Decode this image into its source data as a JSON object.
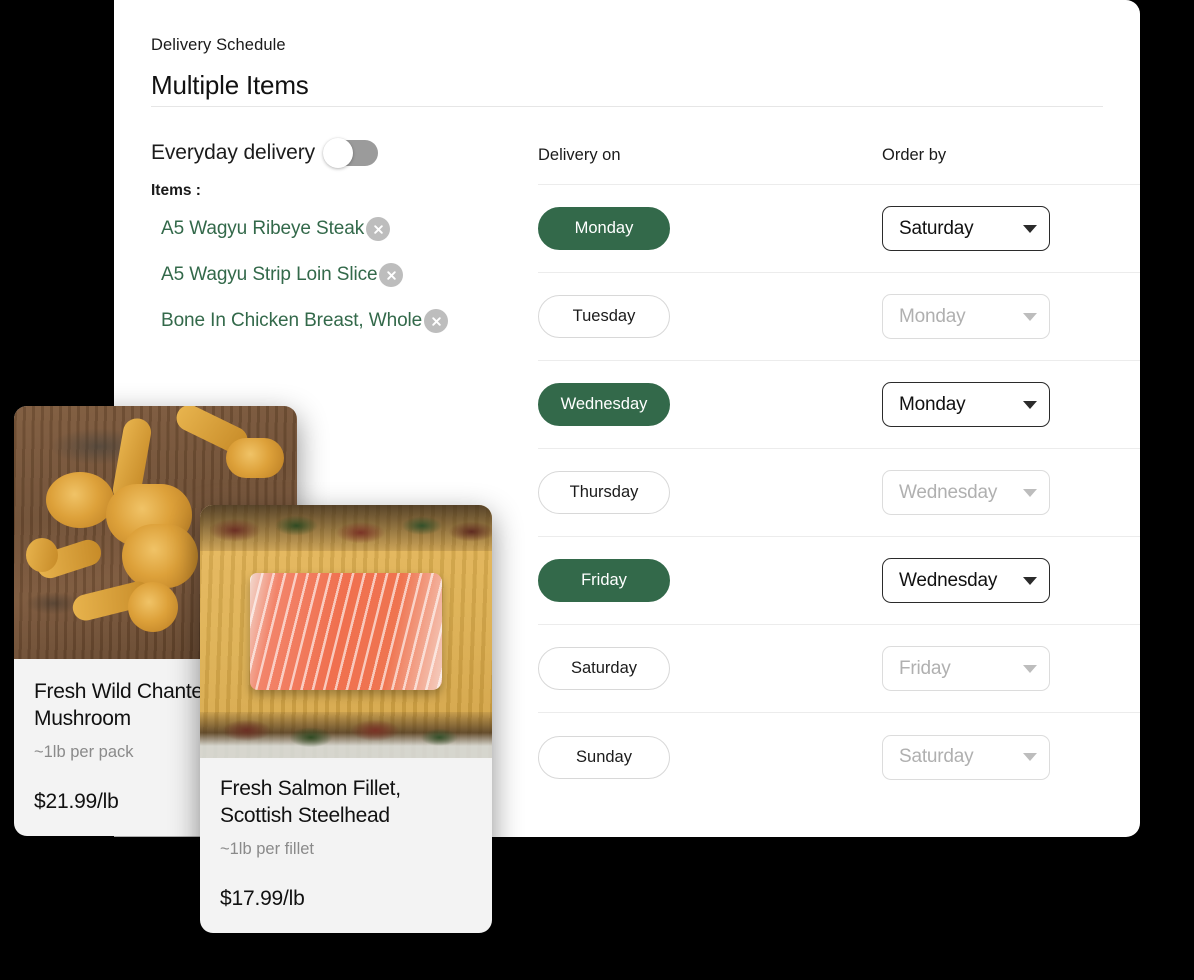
{
  "panel": {
    "eyebrow": "Delivery Schedule",
    "title": "Multiple Items"
  },
  "options": {
    "everyday_delivery_label": "Everyday delivery",
    "everyday_delivery_on": false,
    "items_label": "Items :",
    "items": [
      {
        "name": "A5 Wagyu Ribeye Steak",
        "remove_icon": "close-circle-icon"
      },
      {
        "name": "A5 Wagyu Strip Loin Slice",
        "remove_icon": "close-circle-icon"
      },
      {
        "name": "Bone In Chicken Breast, Whole",
        "remove_icon": "close-circle-icon"
      }
    ]
  },
  "schedule": {
    "headers": {
      "delivery_on": "Delivery on",
      "order_by": "Order by"
    },
    "rows": [
      {
        "day": "Monday",
        "selected": true,
        "order_by": "Saturday"
      },
      {
        "day": "Tuesday",
        "selected": false,
        "order_by": "Monday"
      },
      {
        "day": "Wednesday",
        "selected": true,
        "order_by": "Monday"
      },
      {
        "day": "Thursday",
        "selected": false,
        "order_by": "Wednesday"
      },
      {
        "day": "Friday",
        "selected": true,
        "order_by": "Wednesday"
      },
      {
        "day": "Saturday",
        "selected": false,
        "order_by": "Friday"
      },
      {
        "day": "Sunday",
        "selected": false,
        "order_by": "Saturday"
      }
    ]
  },
  "cards": [
    {
      "title": "Fresh Wild Chanterelle Mushroom",
      "title_line1": "Fresh Wild Chanterelle",
      "title_line2": "Mushroom",
      "subtitle": "~1lb per pack",
      "price": "$21.99/lb",
      "photo": "chanterelle-mushrooms-on-wood-board"
    },
    {
      "title": "Fresh Salmon Fillet, Scottish Steelhead",
      "title_line1": "Fresh Salmon Fillet,",
      "title_line2": "Scottish Steelhead",
      "subtitle": "~1lb per fillet",
      "price": "$17.99/lb",
      "photo": "salmon-fillet-on-bamboo-board"
    }
  ],
  "colors": {
    "brand_green": "#33694a",
    "page_background": "#000000",
    "panel_background": "#ffffff",
    "card_background": "#f3f3f3",
    "muted_text": "#8a8a8a",
    "disabled_text": "#b0b0b0"
  }
}
